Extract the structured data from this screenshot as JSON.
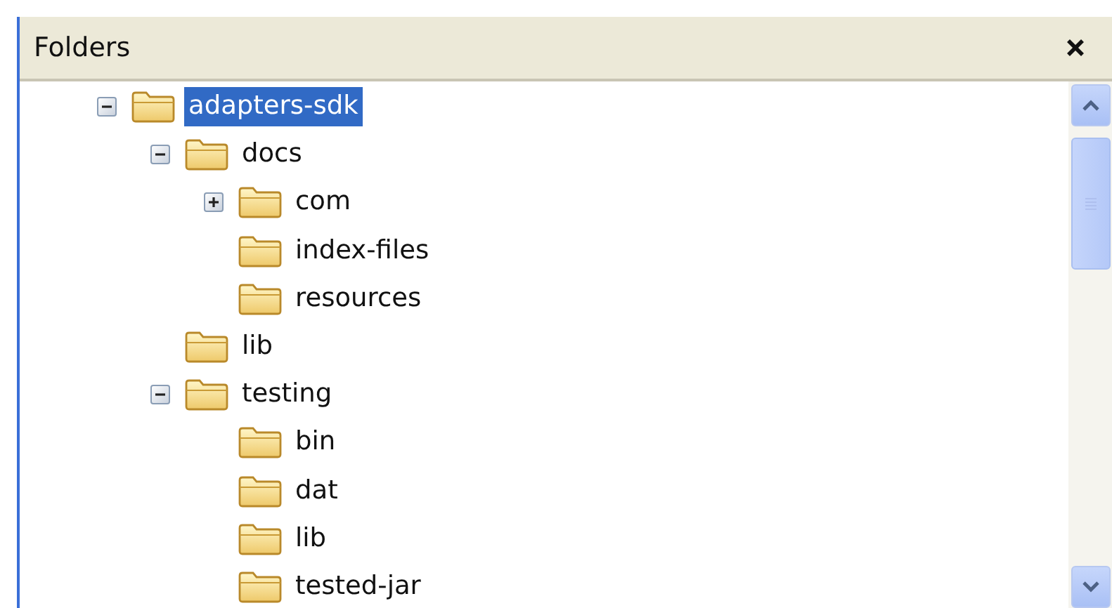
{
  "panel": {
    "title": "Folders"
  },
  "tree": [
    {
      "label": "adapters-sdk",
      "selected": true,
      "expanded": true,
      "children": [
        {
          "label": "docs",
          "selected": false,
          "expanded": true,
          "children": [
            {
              "label": "com",
              "selected": false,
              "expanded": false
            },
            {
              "label": "index-files",
              "selected": false
            },
            {
              "label": "resources",
              "selected": false
            }
          ]
        },
        {
          "label": "lib",
          "selected": false
        },
        {
          "label": "testing",
          "selected": false,
          "expanded": true,
          "children": [
            {
              "label": "bin",
              "selected": false
            },
            {
              "label": "dat",
              "selected": false
            },
            {
              "label": "lib",
              "selected": false
            },
            {
              "label": "tested-jar",
              "selected": false
            }
          ]
        }
      ]
    }
  ]
}
